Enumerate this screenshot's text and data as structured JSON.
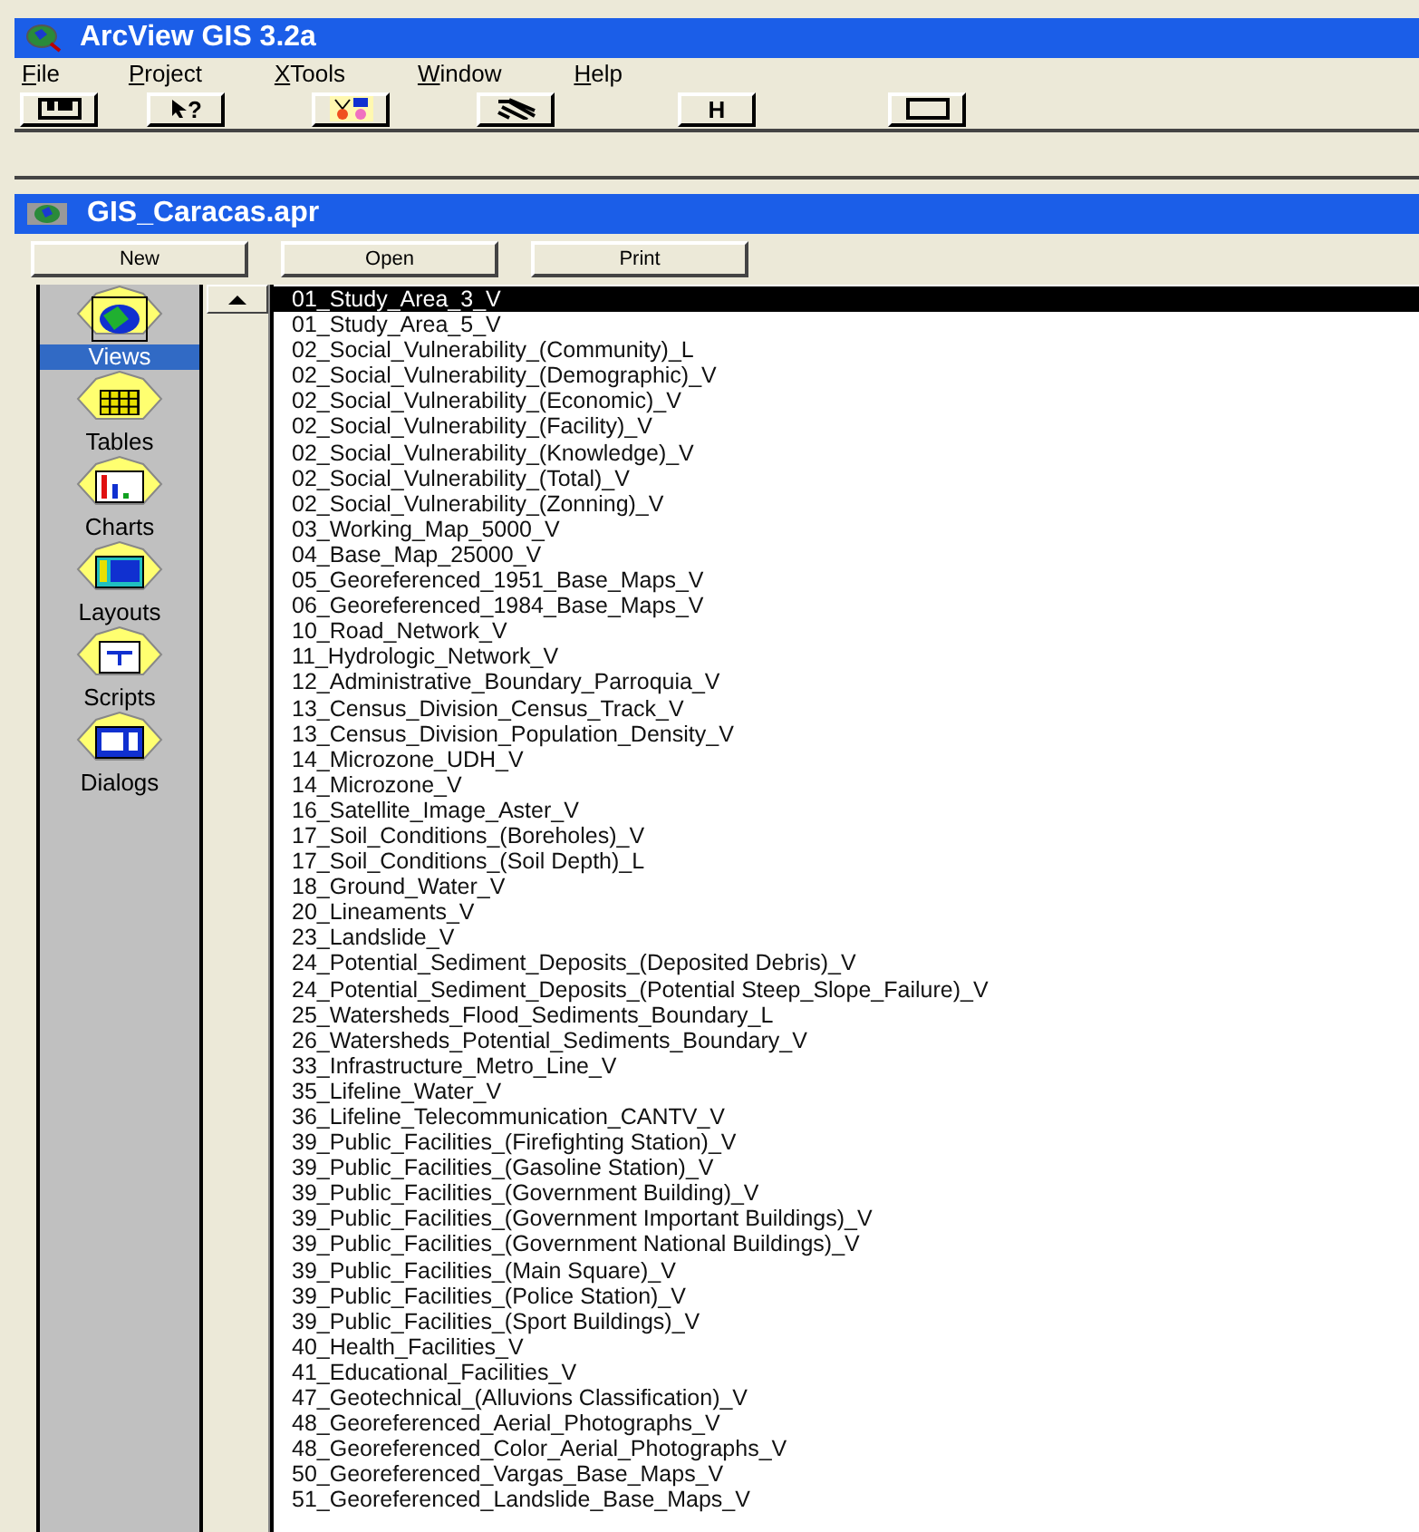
{
  "window": {
    "title": "ArcView GIS 3.2a"
  },
  "menu": [
    "File",
    "Project",
    "XTools",
    "Window",
    "Help"
  ],
  "toolbar": [
    {
      "kind": "save"
    },
    {
      "kind": "help",
      "label": "?"
    },
    {
      "kind": "color"
    },
    {
      "kind": "stripes"
    },
    {
      "kind": "text",
      "label": "H"
    },
    {
      "kind": "rect"
    }
  ],
  "project": {
    "title": "GIS_Caracas.apr",
    "buttons": [
      "New",
      "Open",
      "Print"
    ],
    "doc_types": [
      {
        "label": "Views",
        "kind": "views",
        "selected": true
      },
      {
        "label": "Tables",
        "kind": "tables",
        "selected": false
      },
      {
        "label": "Charts",
        "kind": "charts",
        "selected": false
      },
      {
        "label": "Layouts",
        "kind": "layouts",
        "selected": false
      },
      {
        "label": "Scripts",
        "kind": "scripts",
        "selected": false
      },
      {
        "label": "Dialogs",
        "kind": "dialogs",
        "selected": false
      }
    ],
    "documents": [
      {
        "name": "01_Study_Area_3_V",
        "selected": true
      },
      {
        "name": "01_Study_Area_5_V",
        "selected": false
      },
      {
        "name": "02_Social_Vulnerability_(Community)_L",
        "selected": false
      },
      {
        "name": "02_Social_Vulnerability_(Demographic)_V",
        "selected": false
      },
      {
        "name": "02_Social_Vulnerability_(Economic)_V",
        "selected": false
      },
      {
        "name": "02_Social_Vulnerability_(Facility)_V",
        "selected": false
      },
      {
        "name": "02_Social_Vulnerability_(Knowledge)_V",
        "selected": false
      },
      {
        "name": "02_Social_Vulnerability_(Total)_V",
        "selected": false
      },
      {
        "name": "02_Social_Vulnerability_(Zonning)_V",
        "selected": false
      },
      {
        "name": "03_Working_Map_5000_V",
        "selected": false
      },
      {
        "name": "04_Base_Map_25000_V",
        "selected": false
      },
      {
        "name": "05_Georeferenced_1951_Base_Maps_V",
        "selected": false
      },
      {
        "name": "06_Georeferenced_1984_Base_Maps_V",
        "selected": false
      },
      {
        "name": "10_Road_Network_V",
        "selected": false
      },
      {
        "name": "11_Hydrologic_Network_V",
        "selected": false
      },
      {
        "name": "12_Administrative_Boundary_Parroquia_V",
        "selected": false
      },
      {
        "name": "13_Census_Division_Census_Track_V",
        "selected": false
      },
      {
        "name": "13_Census_Division_Population_Density_V",
        "selected": false
      },
      {
        "name": "14_Microzone_UDH_V",
        "selected": false
      },
      {
        "name": "14_Microzone_V",
        "selected": false
      },
      {
        "name": "16_Satellite_Image_Aster_V",
        "selected": false
      },
      {
        "name": "17_Soil_Conditions_(Boreholes)_V",
        "selected": false
      },
      {
        "name": "17_Soil_Conditions_(Soil Depth)_L",
        "selected": false
      },
      {
        "name": "18_Ground_Water_V",
        "selected": false
      },
      {
        "name": "20_Lineaments_V",
        "selected": false
      },
      {
        "name": "23_Landslide_V",
        "selected": false
      },
      {
        "name": "24_Potential_Sediment_Deposits_(Deposited Debris)_V",
        "selected": false
      },
      {
        "name": "24_Potential_Sediment_Deposits_(Potential Steep_Slope_Failure)_V",
        "selected": false
      },
      {
        "name": "25_Watersheds_Flood_Sediments_Boundary_L",
        "selected": false
      },
      {
        "name": "26_Watersheds_Potential_Sediments_Boundary_V",
        "selected": false
      },
      {
        "name": "33_Infrastructure_Metro_Line_V",
        "selected": false
      },
      {
        "name": "35_Lifeline_Water_V",
        "selected": false
      },
      {
        "name": "36_Lifeline_Telecommunication_CANTV_V",
        "selected": false
      },
      {
        "name": "39_Public_Facilities_(Firefighting Station)_V",
        "selected": false
      },
      {
        "name": "39_Public_Facilities_(Gasoline Station)_V",
        "selected": false
      },
      {
        "name": "39_Public_Facilities_(Government Building)_V",
        "selected": false
      },
      {
        "name": "39_Public_Facilities_(Government Important Buildings)_V",
        "selected": false
      },
      {
        "name": "39_Public_Facilities_(Government National Buildings)_V",
        "selected": false
      },
      {
        "name": "39_Public_Facilities_(Main Square)_V",
        "selected": false
      },
      {
        "name": "39_Public_Facilities_(Police Station)_V",
        "selected": false
      },
      {
        "name": "39_Public_Facilities_(Sport Buildings)_V",
        "selected": false
      },
      {
        "name": "40_Health_Facilities_V",
        "selected": false
      },
      {
        "name": "41_Educational_Facilities_V",
        "selected": false
      },
      {
        "name": "47_Geotechnical_(Alluvions Classification)_V",
        "selected": false
      },
      {
        "name": "48_Georeferenced_Aerial_Photographs_V",
        "selected": false
      },
      {
        "name": "48_Georeferenced_Color_Aerial_Photographs_V",
        "selected": false
      },
      {
        "name": "50_Georeferenced_Vargas_Base_Maps_V",
        "selected": false
      },
      {
        "name": "51_Georeferenced_Landslide_Base_Maps_V",
        "selected": false
      }
    ]
  }
}
